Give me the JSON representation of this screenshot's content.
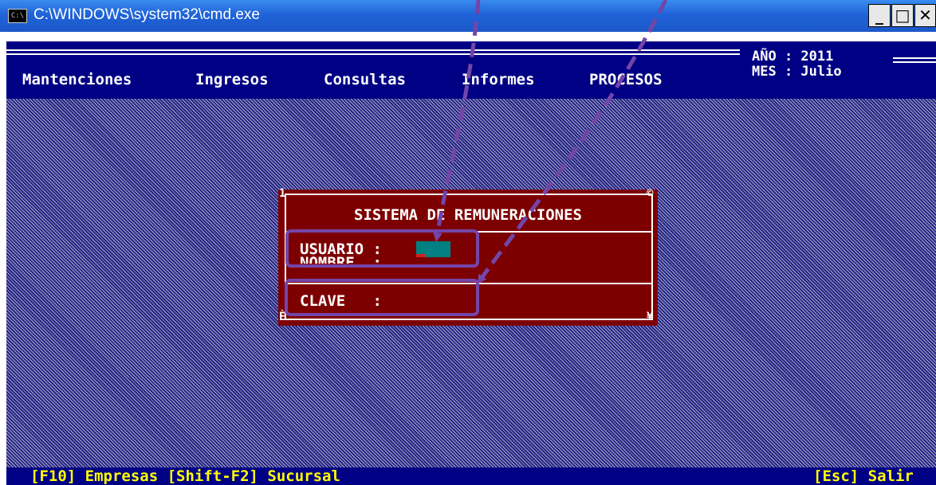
{
  "window": {
    "title": "C:\\WINDOWS\\system32\\cmd.exe",
    "icon": "cmd-icon",
    "icon_text": "C:\\",
    "buttons": {
      "minimize": "_",
      "maximize": "□",
      "close": "✕"
    }
  },
  "menu": {
    "items": [
      "Mantenciones",
      "Ingresos",
      "Consultas",
      "Informes",
      "PROCESOS"
    ],
    "year_label": "AÑO : 2011",
    "month_label": "MES : Julio"
  },
  "dialog": {
    "title": "SISTEMA DE REMUNERACIONES",
    "usuario_label": "USUARIO :",
    "nombre_label": "NOMBRE  :",
    "clave_label": "CLAVE   :",
    "corner_tl": "1",
    "corner_tr": "©",
    "corner_bl": "È",
    "corner_br": "¥"
  },
  "status": {
    "left": "[F10] Empresas [Shift-F2] Sucursal",
    "right": "[Esc] Salir"
  },
  "colors": {
    "menu_bg": "#000084",
    "dialog_bg": "#7d0000",
    "status_text": "#ffff00",
    "highlight": "#7445a8",
    "cursor": "#008080"
  }
}
